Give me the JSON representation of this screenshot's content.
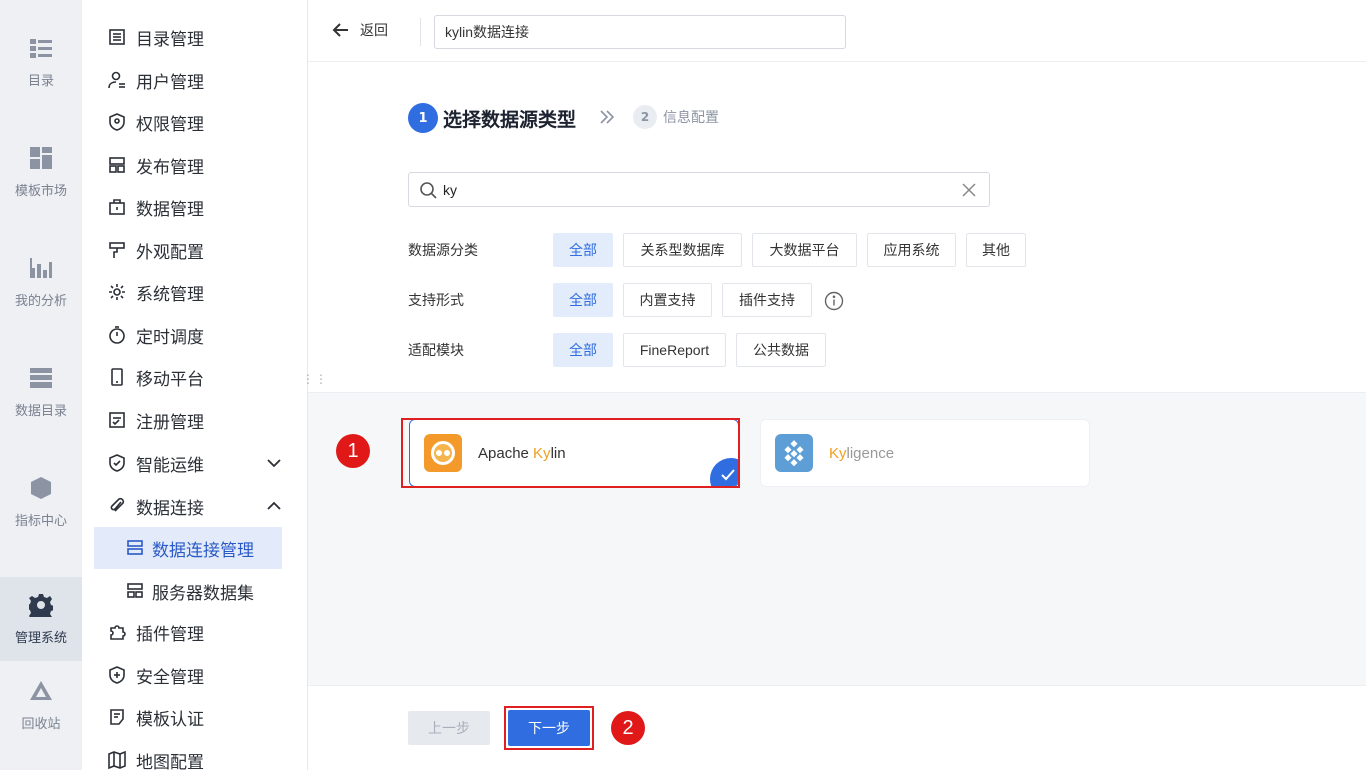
{
  "rail": {
    "items": [
      {
        "label": "目录",
        "icon": "catalog-icon"
      },
      {
        "label": "模板市场",
        "icon": "template-market-icon"
      },
      {
        "label": "我的分析",
        "icon": "analysis-icon"
      },
      {
        "label": "数据目录",
        "icon": "data-catalog-icon"
      },
      {
        "label": "指标中心",
        "icon": "metrics-icon"
      },
      {
        "label": "管理系统",
        "icon": "gear-icon",
        "active": true
      },
      {
        "label": "回收站",
        "icon": "recycle-icon"
      }
    ]
  },
  "menu": {
    "items": [
      {
        "label": "目录管理"
      },
      {
        "label": "用户管理"
      },
      {
        "label": "权限管理"
      },
      {
        "label": "发布管理"
      },
      {
        "label": "数据管理"
      },
      {
        "label": "外观配置"
      },
      {
        "label": "系统管理"
      },
      {
        "label": "定时调度"
      },
      {
        "label": "移动平台"
      },
      {
        "label": "注册管理"
      },
      {
        "label": "智能运维"
      },
      {
        "label": "数据连接"
      },
      {
        "label": "插件管理"
      },
      {
        "label": "安全管理"
      },
      {
        "label": "模板认证"
      },
      {
        "label": "地图配置"
      }
    ],
    "sub": [
      {
        "label": "数据连接管理",
        "active": true
      },
      {
        "label": "服务器数据集"
      }
    ]
  },
  "header": {
    "back_label": "返回",
    "connection_name": "kylin数据连接"
  },
  "steps": [
    {
      "num": "1",
      "label": "选择数据源类型"
    },
    {
      "num": "2",
      "label": "信息配置"
    }
  ],
  "search": {
    "value": "ky"
  },
  "filters": {
    "category": {
      "label": "数据源分类",
      "options": [
        "全部",
        "关系型数据库",
        "大数据平台",
        "应用系统",
        "其他"
      ]
    },
    "support": {
      "label": "支持形式",
      "options": [
        "全部",
        "内置支持",
        "插件支持"
      ]
    },
    "module": {
      "label": "适配模块",
      "options": [
        "全部",
        "FineReport",
        "公共数据"
      ]
    }
  },
  "cards": [
    {
      "pre": "Apache ",
      "hl": "Ky",
      "post": "lin",
      "selected": true
    },
    {
      "pre": "",
      "hl": "Ky",
      "post": "ligence",
      "selected": false
    }
  ],
  "annotations": {
    "badge1": "1",
    "badge2": "2"
  },
  "footer": {
    "prev_label": "上一步",
    "next_label": "下一步"
  },
  "colors": {
    "accent": "#2f6de0",
    "highlight": "#f0a020",
    "annotation": "#e01818"
  }
}
